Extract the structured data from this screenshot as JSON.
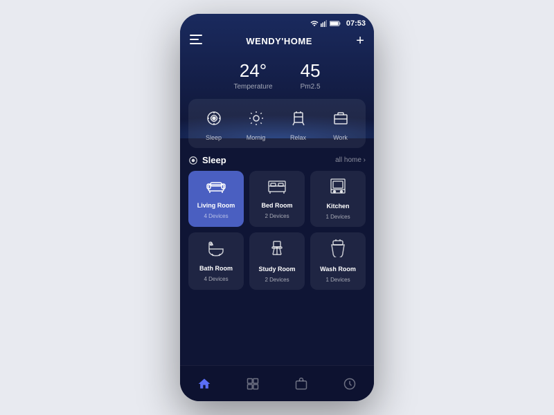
{
  "statusBar": {
    "time": "07:53"
  },
  "header": {
    "title": "WENDY'HOME",
    "addLabel": "+"
  },
  "weather": {
    "temperature": "24°",
    "temperatureLabel": "Temperature",
    "pm25": "45",
    "pm25Label": "Pm2.5"
  },
  "scenes": [
    {
      "id": "sleep",
      "label": "Sleep",
      "icon": "sleep"
    },
    {
      "id": "morning",
      "label": "Mornig",
      "icon": "morning"
    },
    {
      "id": "relax",
      "label": "Relax",
      "icon": "relax"
    },
    {
      "id": "work",
      "label": "Work",
      "icon": "work"
    }
  ],
  "roomSection": {
    "title": "Sleep",
    "linkText": "all home ›"
  },
  "rooms": [
    {
      "id": "living",
      "name": "Living Room",
      "devices": "4 Devices",
      "active": true,
      "icon": "sofa"
    },
    {
      "id": "bedroom",
      "name": "Bed Room",
      "devices": "2 Devices",
      "active": false,
      "icon": "bed"
    },
    {
      "id": "kitchen",
      "name": "Kitchen",
      "devices": "1 Devices",
      "active": false,
      "icon": "kitchen"
    },
    {
      "id": "bathroom",
      "name": "Bath Room",
      "devices": "4 Devices",
      "active": false,
      "icon": "bath"
    },
    {
      "id": "study",
      "name": "Study Room",
      "devices": "2 Devices",
      "active": false,
      "icon": "study"
    },
    {
      "id": "washroom",
      "name": "Wash Room",
      "devices": "1 Devices",
      "active": false,
      "icon": "toilet"
    }
  ],
  "bottomNav": [
    {
      "id": "home",
      "label": "home",
      "active": true
    },
    {
      "id": "grid",
      "label": "grid",
      "active": false
    },
    {
      "id": "bag",
      "label": "bag",
      "active": false
    },
    {
      "id": "clock",
      "label": "clock",
      "active": false
    }
  ]
}
